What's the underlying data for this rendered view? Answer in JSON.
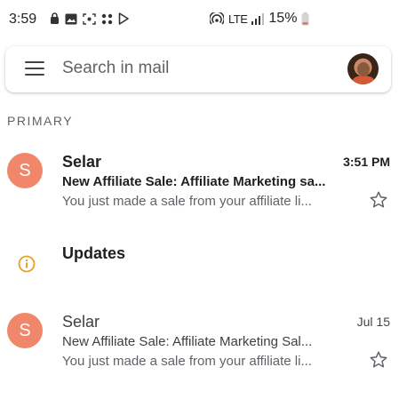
{
  "status_bar": {
    "time": "3:59",
    "network": "LTE",
    "battery": "15%"
  },
  "search": {
    "placeholder": "Search in mail"
  },
  "section": {
    "label": "PRIMARY"
  },
  "emails": [
    {
      "avatar_letter": "S",
      "sender": "Selar",
      "time": "3:51 PM",
      "subject": "New Affiliate Sale: Affiliate Marketing sa...",
      "snippet": "You just made a sale from your affiliate li...",
      "unread": true
    },
    {
      "avatar_letter": "S",
      "sender": "Selar",
      "time": "Jul 15",
      "subject": "New Affiliate Sale: Affiliate Marketing Sal...",
      "snippet": "You just made a sale from your affiliate li...",
      "unread": false
    }
  ],
  "updates": {
    "label": "Updates"
  },
  "colors": {
    "avatar_bg": "#f0866a",
    "updates_icon": "#e8a020"
  },
  "icons": [
    "menu-icon",
    "star-icon",
    "info-icon",
    "hotspot-icon",
    "signal-icon",
    "battery-icon"
  ]
}
